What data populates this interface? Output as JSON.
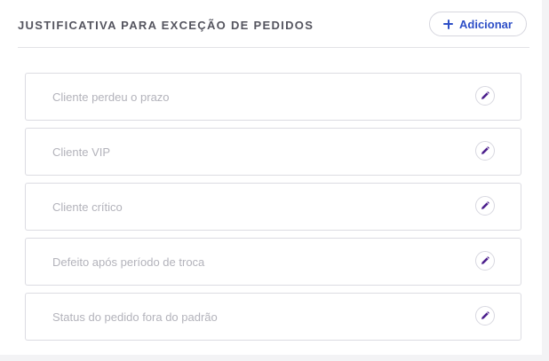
{
  "header": {
    "title": "JUSTIFICATIVA PARA EXCEÇÃO DE PEDIDOS",
    "add_button_label": "Adicionar"
  },
  "items": [
    {
      "label": "Cliente perdeu o prazo"
    },
    {
      "label": "Cliente VIP"
    },
    {
      "label": "Cliente crítico"
    },
    {
      "label": "Defeito após período de troca"
    },
    {
      "label": "Status do pedido fora do padrão"
    }
  ],
  "icons": {
    "add": "plus-icon",
    "edit": "pencil-icon"
  },
  "colors": {
    "accent_blue": "#2e4fc7",
    "edit_icon_purple": "#4b1e8c",
    "title_gray": "#55555f",
    "item_text_gray": "#b3b3bb"
  }
}
